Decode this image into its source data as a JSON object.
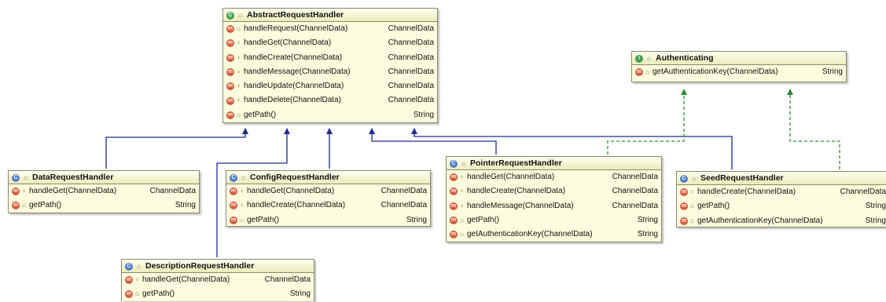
{
  "classes": {
    "abstract_request_handler": {
      "name": "AbstractRequestHandler",
      "methods": [
        {
          "name": "handleRequest(ChannelData)",
          "type": "ChannelData"
        },
        {
          "name": "handleGet(ChannelData)",
          "type": "ChannelData"
        },
        {
          "name": "handleCreate(ChannelData)",
          "type": "ChannelData"
        },
        {
          "name": "handleMessage(ChannelData)",
          "type": "ChannelData"
        },
        {
          "name": "handleUpdate(ChannelData)",
          "type": "ChannelData"
        },
        {
          "name": "handleDelete(ChannelData)",
          "type": "ChannelData"
        },
        {
          "name": "getPath()",
          "type": "String"
        }
      ]
    },
    "authenticating": {
      "name": "Authenticating",
      "methods": [
        {
          "name": "getAuthenticationKey(ChannelData)",
          "type": "String"
        }
      ]
    },
    "data_request_handler": {
      "name": "DataRequestHandler",
      "methods": [
        {
          "name": "handleGet(ChannelData)",
          "type": "ChannelData"
        },
        {
          "name": "getPath()",
          "type": "String"
        }
      ]
    },
    "config_request_handler": {
      "name": "ConfigRequestHandler",
      "methods": [
        {
          "name": "handleGet(ChannelData)",
          "type": "ChannelData"
        },
        {
          "name": "handleCreate(ChannelData)",
          "type": "ChannelData"
        },
        {
          "name": "getPath()",
          "type": "String"
        }
      ]
    },
    "pointer_request_handler": {
      "name": "PointerRequestHandler",
      "methods": [
        {
          "name": "handleGet(ChannelData)",
          "type": "ChannelData"
        },
        {
          "name": "handleCreate(ChannelData)",
          "type": "ChannelData"
        },
        {
          "name": "handleMessage(ChannelData)",
          "type": "ChannelData"
        },
        {
          "name": "getPath()",
          "type": "String"
        },
        {
          "name": "getAuthenticationKey(ChannelData)",
          "type": "String"
        }
      ]
    },
    "seed_request_handler": {
      "name": "SeedRequestHandler",
      "methods": [
        {
          "name": "handleCreate(ChannelData)",
          "type": "ChannelData"
        },
        {
          "name": "getPath()",
          "type": "String"
        },
        {
          "name": "getAuthenticationKey(ChannelData)",
          "type": "String"
        }
      ]
    },
    "description_request_handler": {
      "name": "DescriptionRequestHandler",
      "methods": [
        {
          "name": "handleGet(ChannelData)",
          "type": "ChannelData"
        },
        {
          "name": "getPath()",
          "type": "String"
        }
      ]
    }
  },
  "icons": {
    "class_letter": "C",
    "abstract_letter": "C",
    "interface_letter": "I",
    "method_letter": "m"
  },
  "colors": {
    "inheritance_edge": "#1f2a8c",
    "implements_edge": "#2e8b2e",
    "class_fill": "#fdfcde",
    "method_icon": "#d65b3b"
  }
}
